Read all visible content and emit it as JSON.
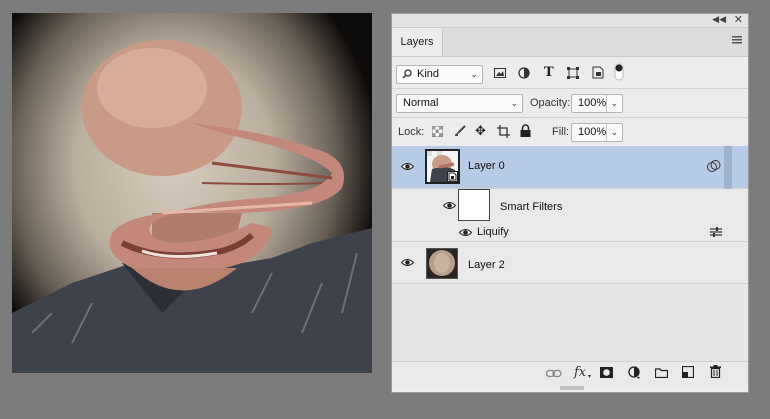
{
  "panel": {
    "collapse_icon": "double-chevron-icon",
    "close_icon": "close-icon",
    "tab_label": "Layers",
    "menu_icon": "hamburger-menu-icon"
  },
  "filter": {
    "kind_label": "Kind",
    "icons": [
      "image-filter-icon",
      "adjustment-filter-icon",
      "type-filter-icon",
      "shape-filter-icon",
      "smart-object-filter-icon",
      "filter-toggle-icon"
    ]
  },
  "blend": {
    "mode": "Normal",
    "opacity_label": "Opacity:",
    "opacity_value": "100%"
  },
  "lock": {
    "label": "Lock:",
    "fill_label": "Fill:",
    "fill_value": "100%"
  },
  "layers": {
    "layer0": {
      "name": "Layer 0",
      "selected": true
    },
    "smart_filters_label": "Smart Filters",
    "liquify_label": "Liquify",
    "layer2": {
      "name": "Layer 2"
    }
  },
  "bottom_icons": [
    "link-icon",
    "fx-icon",
    "mask-icon",
    "adjustment-layer-icon",
    "folder-icon",
    "new-layer-icon",
    "trash-icon"
  ],
  "colors": {
    "selected_row": "#b7cbe6",
    "panel_bg": "#ececec",
    "app_bg": "#7c7c7c"
  }
}
